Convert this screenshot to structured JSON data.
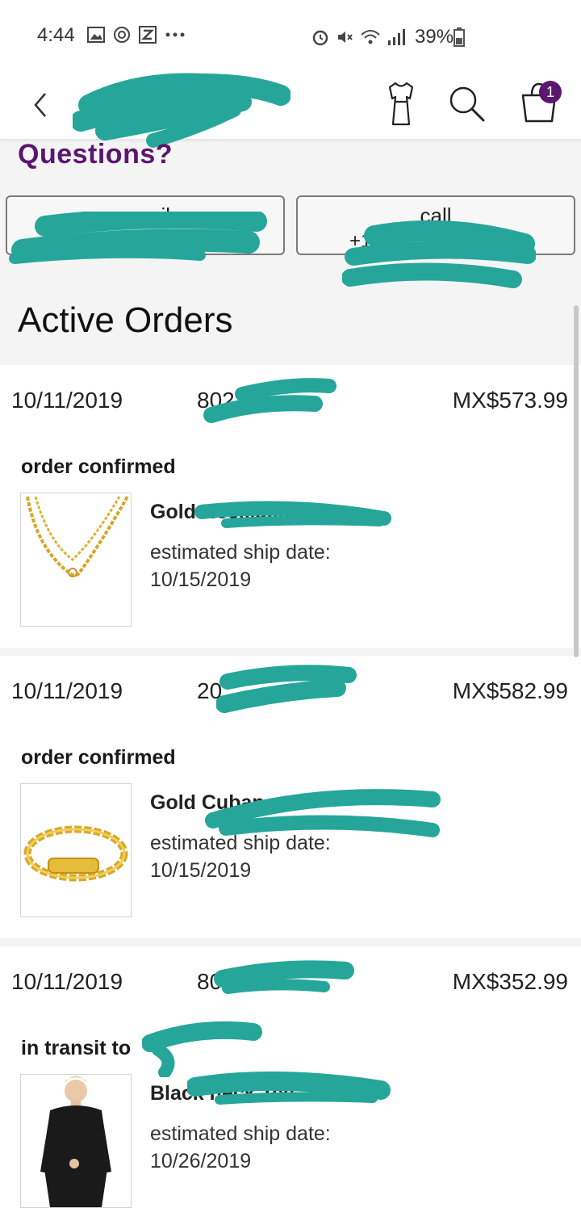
{
  "status_bar": {
    "time": "4:44",
    "battery_text": "39%"
  },
  "app_bar": {
    "cart_count": "1"
  },
  "questions": {
    "title": "Questions?",
    "email_label": "email",
    "call_label": "call",
    "call_value": "+1"
  },
  "active_orders": {
    "title": "Active Orders",
    "orders": [
      {
        "date": "10/11/2019",
        "order_number": "80271",
        "total": "MX$573.99",
        "status": "order confirmed",
        "product_name": "Gold                    Necklace",
        "ship_label": "estimated ship date:",
        "ship_date": "10/15/2019"
      },
      {
        "date": "10/11/2019",
        "order_number": "20",
        "total": "MX$582.99",
        "status": "order confirmed",
        "product_name": "Gold Cuban",
        "ship_label": "estimated ship date:",
        "ship_date": "10/15/2019"
      },
      {
        "date": "10/11/2019",
        "order_number": "80271",
        "total": "MX$352.99",
        "status": "in transit to",
        "product_name": "Black                          neck Tee - Wo...",
        "ship_label": "estimated ship date:",
        "ship_date": "10/26/2019"
      }
    ]
  },
  "colors": {
    "brand_purple": "#5b1670",
    "redaction_teal": "#26a69a"
  }
}
